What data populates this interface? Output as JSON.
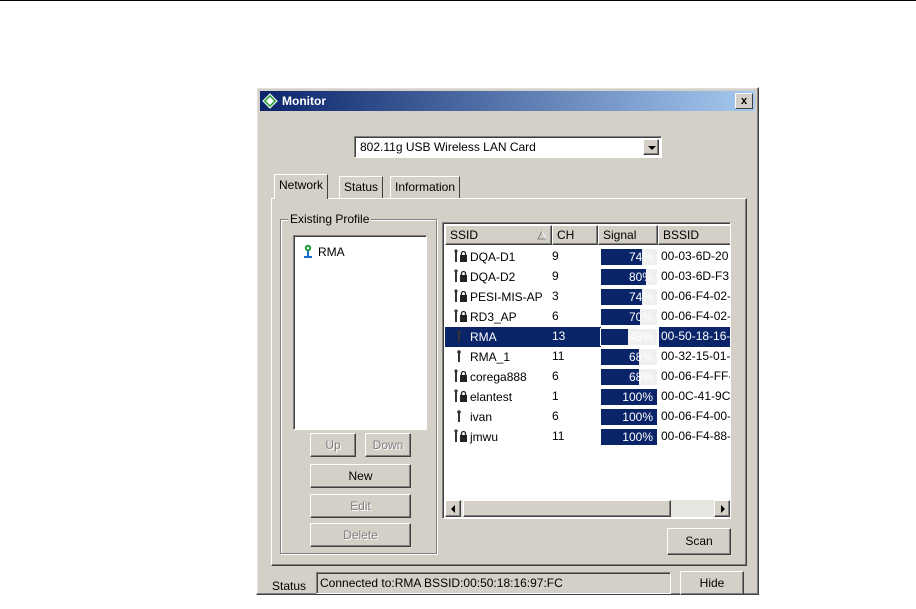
{
  "window": {
    "title": "Monitor",
    "close_label": "x"
  },
  "adapter": {
    "selected": "802.11g USB Wireless LAN Card"
  },
  "tabs": [
    {
      "label": "Network",
      "active": true
    },
    {
      "label": "Status",
      "active": false
    },
    {
      "label": "Information",
      "active": false
    }
  ],
  "profiles": {
    "group_label": "Existing Profile",
    "items": [
      {
        "name": "RMA"
      }
    ],
    "buttons": {
      "up": "Up",
      "down": "Down",
      "new": "New",
      "edit": "Edit",
      "delete": "Delete"
    }
  },
  "networks": {
    "columns": {
      "ssid": "SSID",
      "ch": "CH",
      "signal": "Signal",
      "bssid": "BSSID"
    },
    "sort": "ssid-ascending",
    "rows": [
      {
        "ssid": "DQA-D1",
        "ch": "9",
        "signal": 74,
        "signal_label": "74%",
        "bssid": "00-03-6D-20",
        "secured": true,
        "selected": false
      },
      {
        "ssid": "DQA-D2",
        "ch": "9",
        "signal": 80,
        "signal_label": "80%",
        "bssid": "00-03-6D-F3",
        "secured": true,
        "selected": false
      },
      {
        "ssid": "PESI-MIS-AP",
        "ch": "3",
        "signal": 74,
        "signal_label": "74%",
        "bssid": "00-06-F4-02-",
        "secured": true,
        "selected": false
      },
      {
        "ssid": "RD3_AP",
        "ch": "6",
        "signal": 70,
        "signal_label": "70%",
        "bssid": "00-06-F4-02-",
        "secured": true,
        "selected": false
      },
      {
        "ssid": "RMA",
        "ch": "13",
        "signal": 48,
        "signal_label": "48%",
        "bssid": "00-50-18-16-",
        "secured": false,
        "selected": true
      },
      {
        "ssid": "RMA_1",
        "ch": "11",
        "signal": 68,
        "signal_label": "68%",
        "bssid": "00-32-15-01-",
        "secured": false,
        "selected": false
      },
      {
        "ssid": "corega888",
        "ch": "6",
        "signal": 68,
        "signal_label": "68%",
        "bssid": "00-06-F4-FF-",
        "secured": true,
        "selected": false
      },
      {
        "ssid": "elantest",
        "ch": "1",
        "signal": 100,
        "signal_label": "100%",
        "bssid": "00-0C-41-9C",
        "secured": true,
        "selected": false
      },
      {
        "ssid": "ivan",
        "ch": "6",
        "signal": 100,
        "signal_label": "100%",
        "bssid": "00-06-F4-00-",
        "secured": false,
        "selected": false
      },
      {
        "ssid": "jmwu",
        "ch": "11",
        "signal": 100,
        "signal_label": "100%",
        "bssid": "00-06-F4-88-",
        "secured": true,
        "selected": false
      }
    ],
    "scan_label": "Scan"
  },
  "status": {
    "label": "Status",
    "text": "Connected to:RMA    BSSID:00:50:18:16:97:FC",
    "hide_label": "Hide"
  },
  "colors": {
    "titlebar": "#0a246a",
    "face": "#d4d0c8",
    "selection": "#0a246a"
  }
}
